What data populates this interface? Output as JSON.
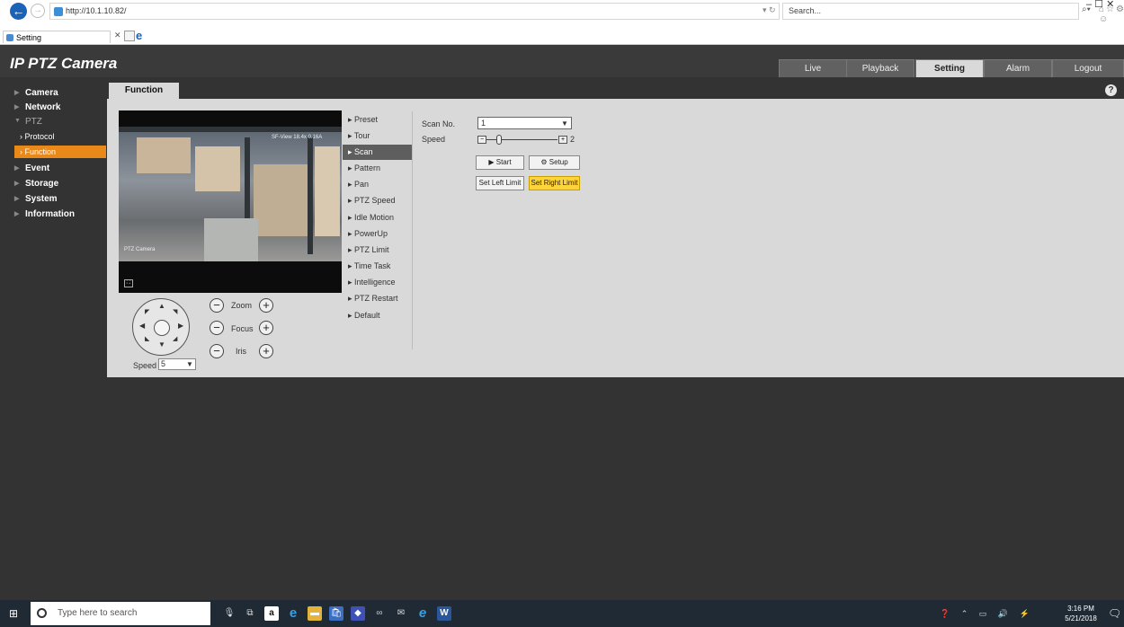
{
  "browser": {
    "url": "http://10.1.10.82/",
    "search_placeholder": "Search...",
    "refresh_glyph": "▾ ↻",
    "tab_title": "Setting",
    "window_controls": "–   ☐   ✕"
  },
  "app": {
    "title": "IP PTZ Camera",
    "nav_tabs": [
      "Live",
      "Playback",
      "Setting",
      "Alarm",
      "Logout"
    ],
    "active_tab": "Setting"
  },
  "sidebar": {
    "items": [
      "Camera",
      "Network",
      "PTZ",
      "Event",
      "Storage",
      "System",
      "Information"
    ],
    "ptz_sub": [
      "Protocol",
      "Function"
    ],
    "active_sub": "Function"
  },
  "panel": {
    "tab_label": "Function",
    "help_glyph": "?",
    "video_overlay_title": "SF-View 18.4x 0.16A",
    "video_overlay_cam": "PTZ Camera"
  },
  "ptz_controls": {
    "zoom_label": "Zoom",
    "focus_label": "Focus",
    "iris_label": "Iris",
    "speed_label": "Speed",
    "speed_value": "5"
  },
  "function_list": [
    "Preset",
    "Tour",
    "Scan",
    "Pattern",
    "Pan",
    "PTZ Speed",
    "Idle Motion",
    "PowerUp",
    "PTZ Limit",
    "Time Task",
    "Intelligence",
    "PTZ Restart",
    "Default"
  ],
  "active_function": "Scan",
  "scan": {
    "scan_no_label": "Scan No.",
    "scan_no_value": "1",
    "speed_label": "Speed",
    "speed_value": "2",
    "start_label": "Start",
    "setup_label": "Setup",
    "set_left_label": "Set Left Limit",
    "set_right_label": "Set Right Limit"
  },
  "taskbar": {
    "search_placeholder": "Type here to search",
    "time": "3:16 PM",
    "date": "5/21/2018"
  },
  "colors": {
    "accent_orange": "#e8891a",
    "highlight_yellow": "#ffd43b",
    "header_bg": "#3a3a3a"
  }
}
